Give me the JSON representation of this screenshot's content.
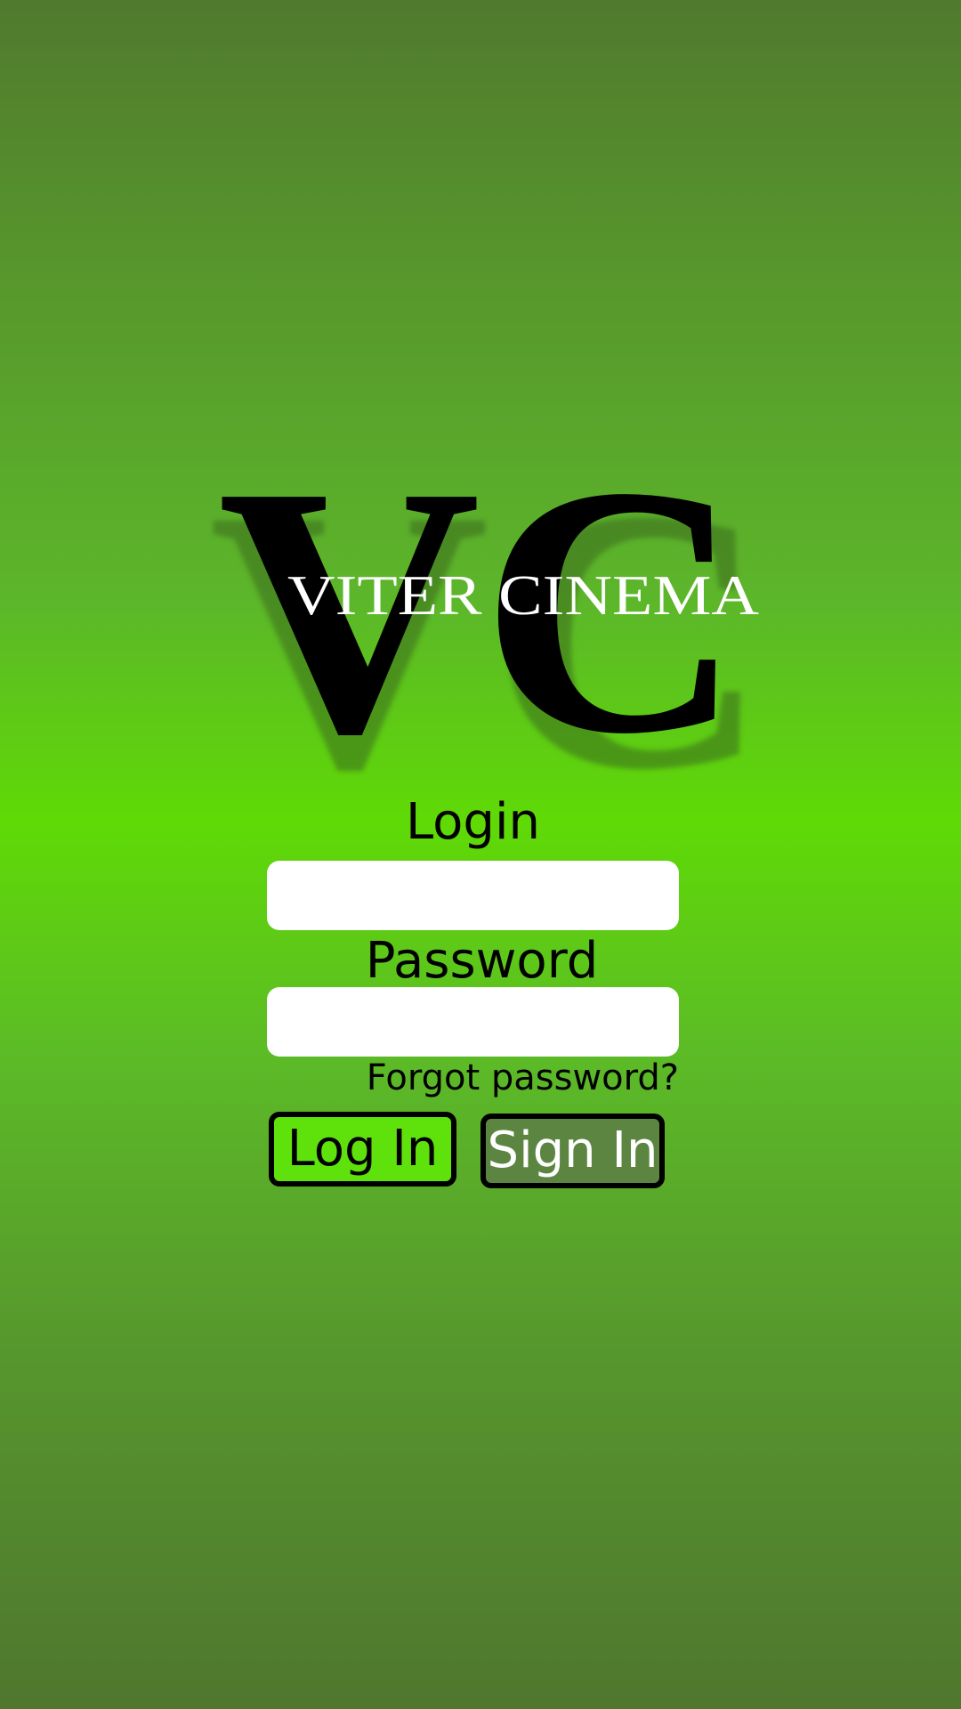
{
  "brand": {
    "monogram": "VC",
    "name": "VITER CINEMA"
  },
  "form": {
    "login_label": "Login",
    "login_value": "",
    "password_label": "Password",
    "password_value": "",
    "forgot_password": "Forgot password?"
  },
  "buttons": {
    "log_in": "Log In",
    "sign_in": "Sign In"
  },
  "colors": {
    "background_center": "#5fda06",
    "background_edge": "#4f772e",
    "log_in_button": "#5fe20b",
    "sign_in_button": "#5b8540"
  }
}
